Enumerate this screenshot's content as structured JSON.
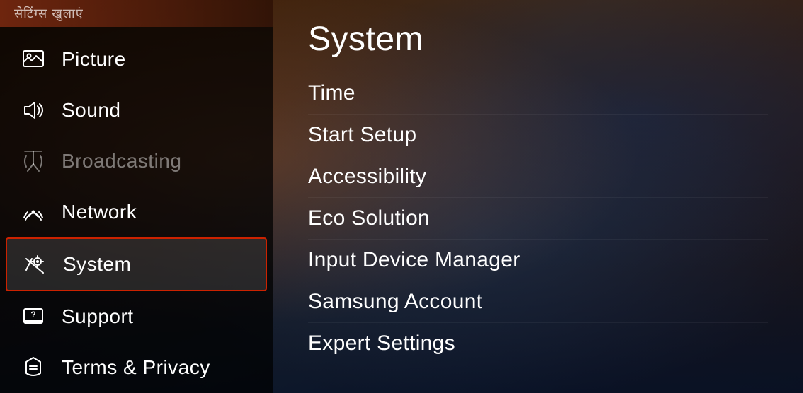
{
  "sidebar": {
    "banner_text": "सेटिंग्स खुलाएं",
    "items": [
      {
        "id": "picture",
        "label": "Picture",
        "icon": "picture-icon",
        "active": false,
        "dimmed": false
      },
      {
        "id": "sound",
        "label": "Sound",
        "icon": "sound-icon",
        "active": false,
        "dimmed": false
      },
      {
        "id": "broadcasting",
        "label": "Broadcasting",
        "icon": "broadcasting-icon",
        "active": false,
        "dimmed": true
      },
      {
        "id": "network",
        "label": "Network",
        "icon": "network-icon",
        "active": false,
        "dimmed": false
      },
      {
        "id": "system",
        "label": "System",
        "icon": "system-icon",
        "active": true,
        "dimmed": false
      },
      {
        "id": "support",
        "label": "Support",
        "icon": "support-icon",
        "active": false,
        "dimmed": false
      },
      {
        "id": "terms",
        "label": "Terms & Privacy",
        "icon": "terms-icon",
        "active": false,
        "dimmed": false
      }
    ]
  },
  "main": {
    "title": "System",
    "menu_items": [
      {
        "id": "time",
        "label": "Time"
      },
      {
        "id": "start-setup",
        "label": "Start Setup"
      },
      {
        "id": "accessibility",
        "label": "Accessibility"
      },
      {
        "id": "eco-solution",
        "label": "Eco Solution"
      },
      {
        "id": "input-device-manager",
        "label": "Input Device Manager"
      },
      {
        "id": "samsung-account",
        "label": "Samsung Account"
      },
      {
        "id": "expert-settings",
        "label": "Expert Settings"
      }
    ]
  }
}
